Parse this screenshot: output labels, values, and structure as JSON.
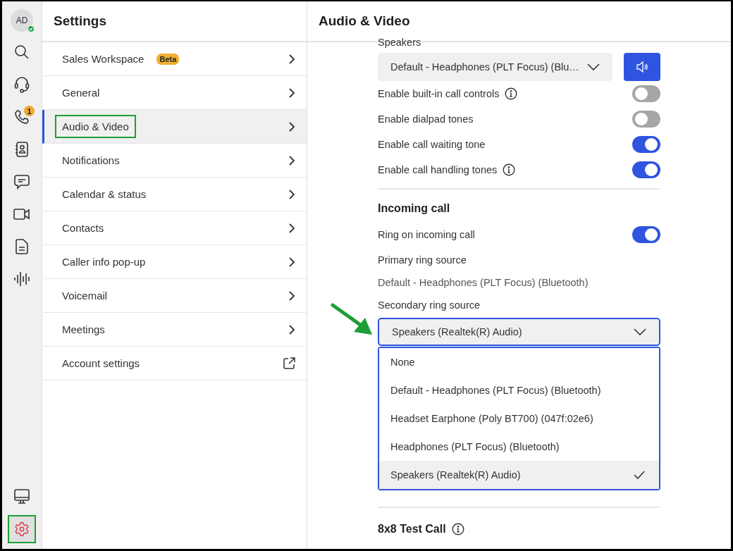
{
  "rail": {
    "avatar": {
      "initials": "AD",
      "online": true
    },
    "items": [
      {
        "kind": "search",
        "selected": false
      },
      {
        "kind": "headset",
        "selected": false
      },
      {
        "kind": "phone",
        "selected": false,
        "badge": "1"
      },
      {
        "kind": "contacts",
        "selected": false
      },
      {
        "kind": "chat",
        "selected": false
      },
      {
        "kind": "video",
        "selected": false
      },
      {
        "kind": "document",
        "selected": false
      },
      {
        "kind": "waveform",
        "selected": false
      }
    ],
    "bottom_items": [
      {
        "kind": "monitor",
        "selected": false,
        "annotated": false
      },
      {
        "kind": "gear",
        "selected": true,
        "annotated": true
      }
    ]
  },
  "settings": {
    "title": "Settings",
    "items": [
      {
        "label": "Sales Workspace",
        "badge": "Beta",
        "selected": false,
        "annotated": false,
        "kind": "chevron"
      },
      {
        "label": "General",
        "selected": false,
        "annotated": false,
        "kind": "chevron"
      },
      {
        "label": "Audio & Video",
        "selected": true,
        "annotated": true,
        "kind": "chevron"
      },
      {
        "label": "Notifications",
        "selected": false,
        "annotated": false,
        "kind": "chevron"
      },
      {
        "label": "Calendar & status",
        "selected": false,
        "annotated": false,
        "kind": "chevron"
      },
      {
        "label": "Contacts",
        "selected": false,
        "annotated": false,
        "kind": "chevron"
      },
      {
        "label": "Caller info pop-up",
        "selected": false,
        "annotated": false,
        "kind": "chevron"
      },
      {
        "label": "Voicemail",
        "selected": false,
        "annotated": false,
        "kind": "chevron"
      },
      {
        "label": "Meetings",
        "selected": false,
        "annotated": false,
        "kind": "chevron"
      },
      {
        "label": "Account settings",
        "selected": false,
        "annotated": false,
        "kind": "external"
      }
    ]
  },
  "panel": {
    "title": "Audio & Video",
    "speakers": {
      "label": "Speakers",
      "value": "Default - Headphones (PLT Focus) (Blu…"
    },
    "toggles": [
      {
        "label": "Enable built-in call controls",
        "info": true,
        "on": false
      },
      {
        "label": "Enable dialpad tones",
        "info": false,
        "on": false
      },
      {
        "label": "Enable call waiting tone",
        "info": false,
        "on": true
      },
      {
        "label": "Enable call handling tones",
        "info": true,
        "on": true
      }
    ],
    "incoming": {
      "heading": "Incoming call",
      "ring": {
        "label": "Ring on incoming call",
        "on": true
      },
      "primary_label": "Primary ring source",
      "primary_value": "Default - Headphones (PLT Focus) (Bluetooth)",
      "secondary_label": "Secondary ring source",
      "secondary": {
        "value": "Speakers (Realtek(R) Audio)",
        "expanded": true,
        "annotated": true,
        "options": [
          {
            "label": "None",
            "selected": false
          },
          {
            "label": "Default - Headphones (PLT Focus) (Bluetooth)",
            "selected": false
          },
          {
            "label": "Headset Earphone (Poly BT700) (047f:02e6)",
            "selected": false
          },
          {
            "label": "Headphones (PLT Focus) (Bluetooth)",
            "selected": false
          },
          {
            "label": "Speakers (Realtek(R) Audio)",
            "selected": true
          }
        ]
      }
    },
    "test_call": {
      "heading": "8x8 Test Call",
      "info": true
    }
  }
}
